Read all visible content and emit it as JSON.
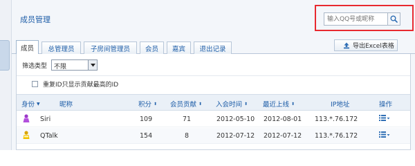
{
  "header": {
    "title": "成员管理"
  },
  "search": {
    "placeholder": "输入QQ号或昵称"
  },
  "tabs": [
    {
      "label": "成员",
      "active": true
    },
    {
      "label": "总管理员"
    },
    {
      "label": "子房间管理员"
    },
    {
      "label": "会员"
    },
    {
      "label": "嘉宾"
    },
    {
      "label": "退出记录"
    }
  ],
  "export": {
    "label": "导出Excel表格"
  },
  "filter": {
    "label": "筛选类型",
    "selected": "不限"
  },
  "dedupe": {
    "label": "重复ID只显示贡献最高的ID"
  },
  "table": {
    "headers": {
      "role": "身份",
      "nickname": "昵称",
      "points": "积分",
      "contribution": "会员贡献",
      "join_time": "入会时间",
      "last_online": "最近上线",
      "ip": "IP地址",
      "action": "操作"
    },
    "rows": [
      {
        "role_icon": "purple-person-icon",
        "nickname": "Siri",
        "points": "109",
        "contribution": "71",
        "join_time": "2012-05-10",
        "last_online": "2012-08-01",
        "ip": "113.*.76.172"
      },
      {
        "role_icon": "yellow-person-icon",
        "nickname": "QTalk",
        "points": "154",
        "contribution": "8",
        "join_time": "2012-07-12",
        "last_online": "2012-07-12",
        "ip": "113.*.76.172"
      }
    ]
  },
  "colors": {
    "accent": "#1f5ea8",
    "highlight_frame": "#e8292f"
  }
}
